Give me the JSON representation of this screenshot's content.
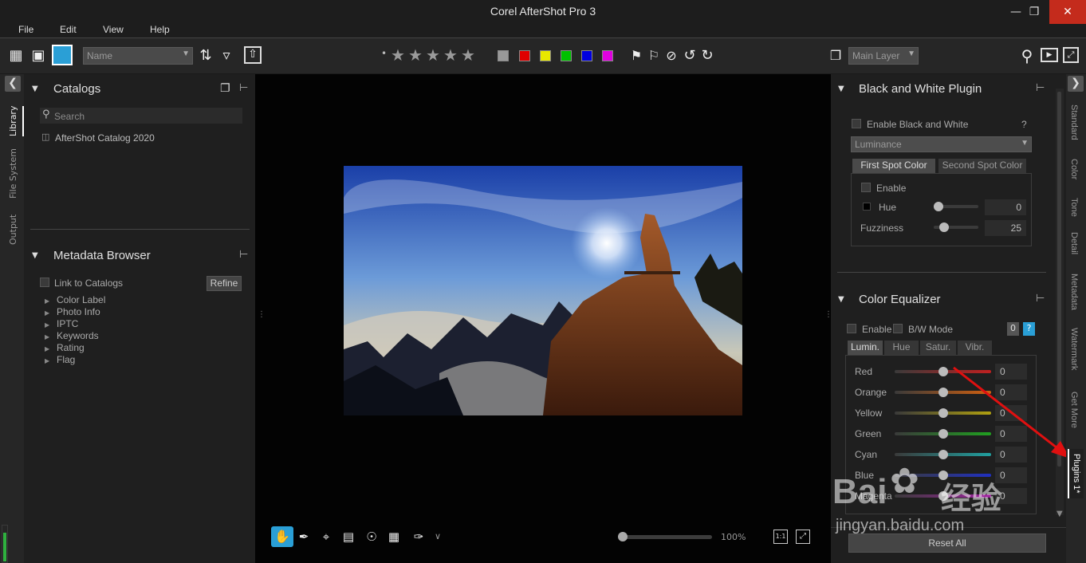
{
  "app": {
    "title": "Corel AfterShot Pro 3"
  },
  "menu": {
    "file": "File",
    "edit": "Edit",
    "view": "View",
    "help": "Help"
  },
  "toolbar": {
    "sort_value": "Name",
    "layer_value": "Main Layer",
    "colors": [
      "#999999",
      "#e00000",
      "#e8e800",
      "#00c000",
      "#0000e0",
      "#e000e0"
    ]
  },
  "left_tabs": [
    "Library",
    "File System",
    "Output"
  ],
  "catalogs": {
    "title": "Catalogs",
    "search_placeholder": "Search",
    "items": [
      "AfterShot Catalog 2020"
    ]
  },
  "metadata": {
    "title": "Metadata Browser",
    "link_label": "Link to Catalogs",
    "refine_label": "Refine",
    "items": [
      "Color Label",
      "Photo Info",
      "IPTC",
      "Keywords",
      "Rating",
      "Flag"
    ]
  },
  "viewer": {
    "zoom": "100%",
    "zoom_level": 0.0,
    "one_to_one": "1:1"
  },
  "bw_plugin": {
    "title": "Black and White Plugin",
    "enable_label": "Enable Black and White",
    "help": "?",
    "mode": "Luminance",
    "tabs": [
      "First Spot Color",
      "Second Spot Color"
    ],
    "spot_enable": "Enable",
    "hue_label": "Hue",
    "hue_value": "0",
    "fuzz_label": "Fuzziness",
    "fuzz_value": "25"
  },
  "color_eq": {
    "title": "Color Equalizer",
    "enable_label": "Enable",
    "bw_label": "B/W Mode",
    "count": "0",
    "help": "?",
    "tabs": [
      "Lumin.",
      "Hue",
      "Satur.",
      "Vibr."
    ],
    "rows": [
      {
        "label": "Red",
        "value": "0",
        "color": "#c02020"
      },
      {
        "label": "Orange",
        "value": "0",
        "color": "#d06010"
      },
      {
        "label": "Yellow",
        "value": "0",
        "color": "#b0a010"
      },
      {
        "label": "Green",
        "value": "0",
        "color": "#20a020"
      },
      {
        "label": "Cyan",
        "value": "0",
        "color": "#20a0a0"
      },
      {
        "label": "Blue",
        "value": "0",
        "color": "#2030c0"
      },
      {
        "label": "Magenta",
        "value": "0",
        "color": "#a020a0"
      }
    ],
    "reset_label": "Reset All"
  },
  "right_tabs": [
    "Standard",
    "Color",
    "Tone",
    "Detail",
    "Metadata",
    "Watermark",
    "Get More",
    "Plugins 1*"
  ],
  "watermark": {
    "line1": "Bai",
    "line2": "经验",
    "line3": "jingyan.baidu.com"
  }
}
